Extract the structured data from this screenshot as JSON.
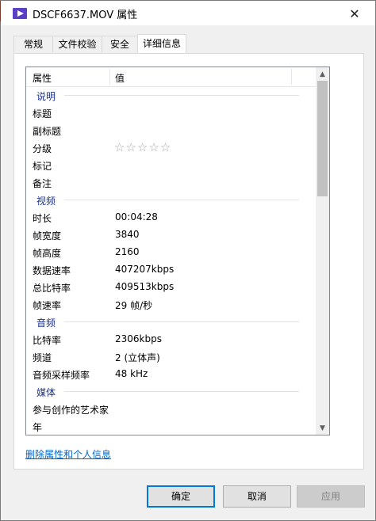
{
  "window": {
    "title": "DSCF6637.MOV 属性"
  },
  "tabs": [
    {
      "label": "常规",
      "active": false
    },
    {
      "label": "文件校验",
      "active": false
    },
    {
      "label": "安全",
      "active": false
    },
    {
      "label": "详细信息",
      "active": true
    }
  ],
  "columns": {
    "property": "属性",
    "value": "值"
  },
  "groups": {
    "description": {
      "label": "说明",
      "rows": [
        {
          "key": "标题",
          "value": ""
        },
        {
          "key": "副标题",
          "value": ""
        },
        {
          "key": "分级",
          "value": "☆☆☆☆☆",
          "rating_stars": 0
        },
        {
          "key": "标记",
          "value": ""
        },
        {
          "key": "备注",
          "value": ""
        }
      ]
    },
    "video": {
      "label": "视频",
      "rows": [
        {
          "key": "时长",
          "value": "00:04:28"
        },
        {
          "key": "帧宽度",
          "value": "3840"
        },
        {
          "key": "帧高度",
          "value": "2160"
        },
        {
          "key": "数据速率",
          "value": "407207kbps"
        },
        {
          "key": "总比特率",
          "value": "409513kbps"
        },
        {
          "key": "帧速率",
          "value": "29 帧/秒"
        }
      ]
    },
    "audio": {
      "label": "音频",
      "rows": [
        {
          "key": "比特率",
          "value": "2306kbps"
        },
        {
          "key": "频道",
          "value": "2 (立体声)"
        },
        {
          "key": "音频采样频率",
          "value": "48 kHz"
        }
      ]
    },
    "media": {
      "label": "媒体",
      "rows": [
        {
          "key": "参与创作的艺术家",
          "value": ""
        },
        {
          "key": "年",
          "value": ""
        }
      ]
    }
  },
  "link": {
    "label": "删除属性和个人信息"
  },
  "buttons": {
    "ok": "确定",
    "cancel": "取消",
    "apply": "应用"
  },
  "colors": {
    "link": "#0066cc",
    "group_label": "#1e3287",
    "ok_border": "#0078d7"
  }
}
